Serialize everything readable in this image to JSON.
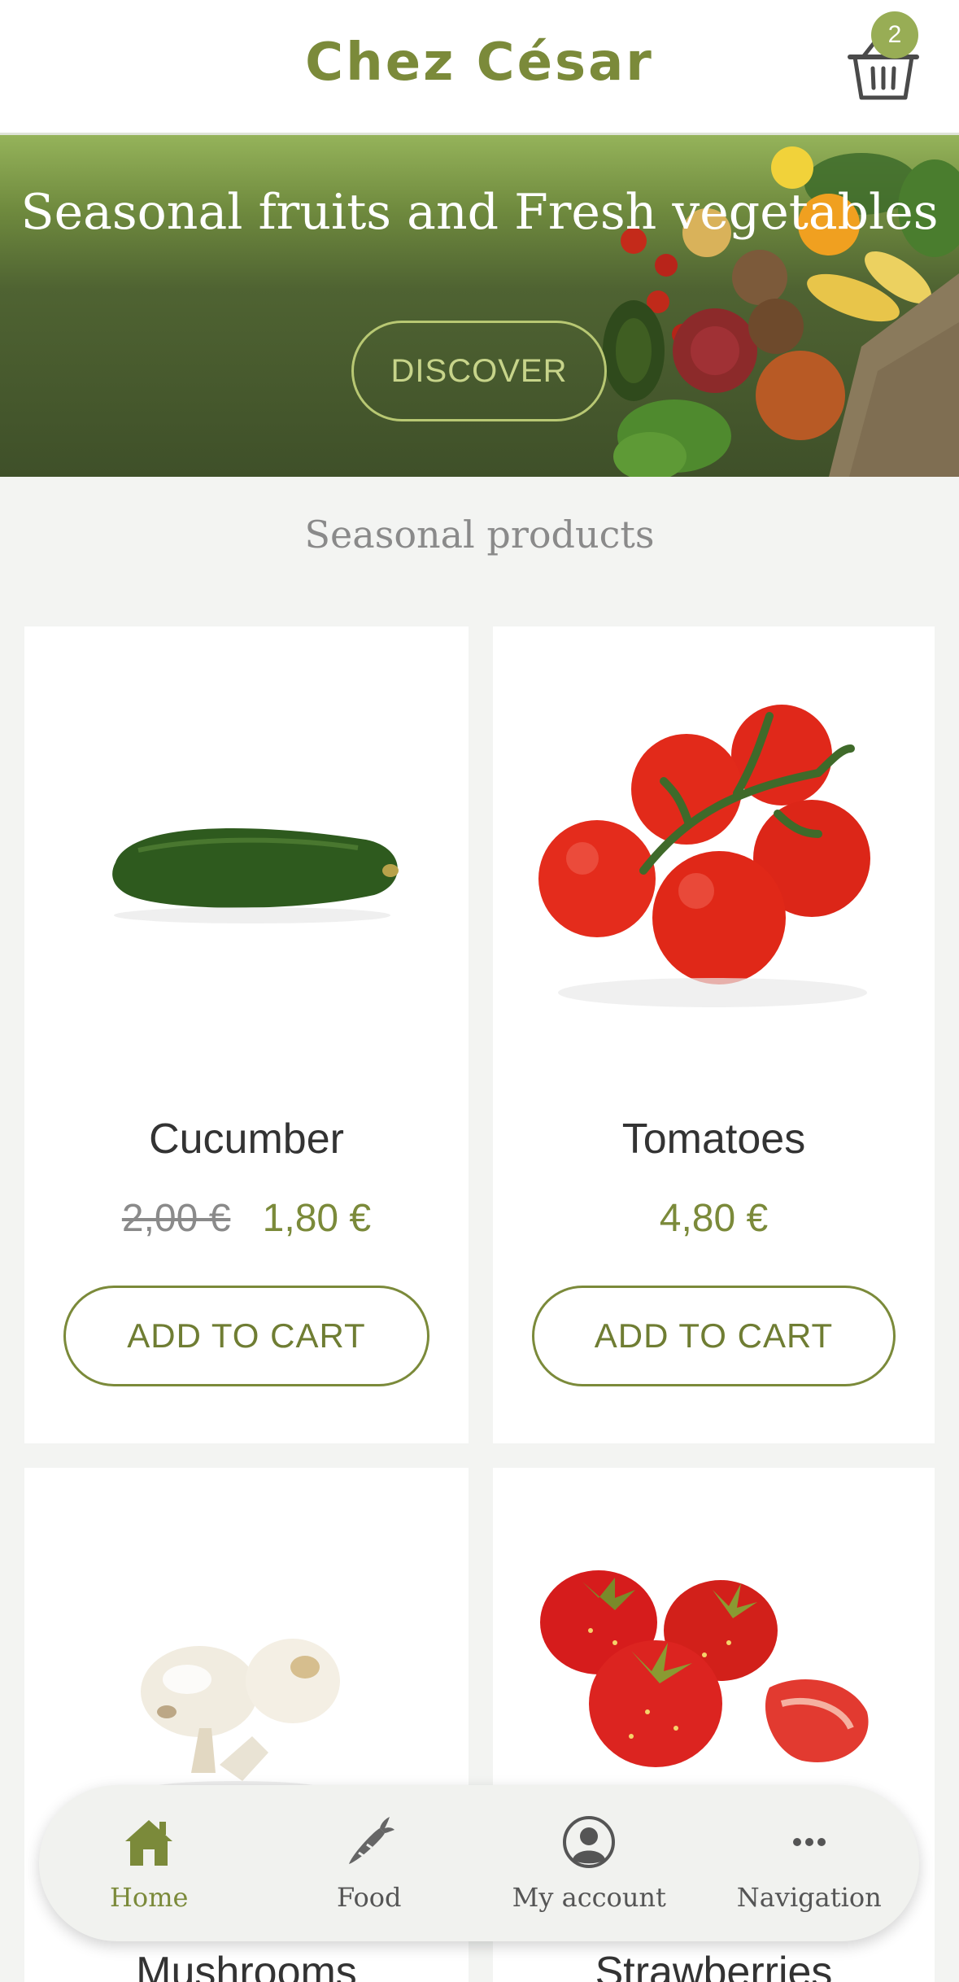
{
  "header": {
    "brand": "Chez César",
    "cart_count": "2"
  },
  "hero": {
    "title": "Seasonal fruits and Fresh vegetables",
    "button": "DISCOVER"
  },
  "section": {
    "title": "Seasonal products"
  },
  "products": [
    {
      "name": "Cucumber",
      "old_price": "2,00 €",
      "price": "1,80 €",
      "button": "ADD TO CART"
    },
    {
      "name": "Tomatoes",
      "old_price": "",
      "price": "4,80 €",
      "button": "ADD TO CART"
    },
    {
      "name": "Mushrooms"
    },
    {
      "name": "Strawberries"
    }
  ],
  "nav": [
    {
      "label": "Home",
      "icon": "home-icon"
    },
    {
      "label": "Food",
      "icon": "carrot-icon"
    },
    {
      "label": "My account",
      "icon": "account-icon"
    },
    {
      "label": "Navigation",
      "icon": "more-icon"
    }
  ],
  "colors": {
    "brand": "#7b8a3a",
    "badge": "#98ad55"
  }
}
